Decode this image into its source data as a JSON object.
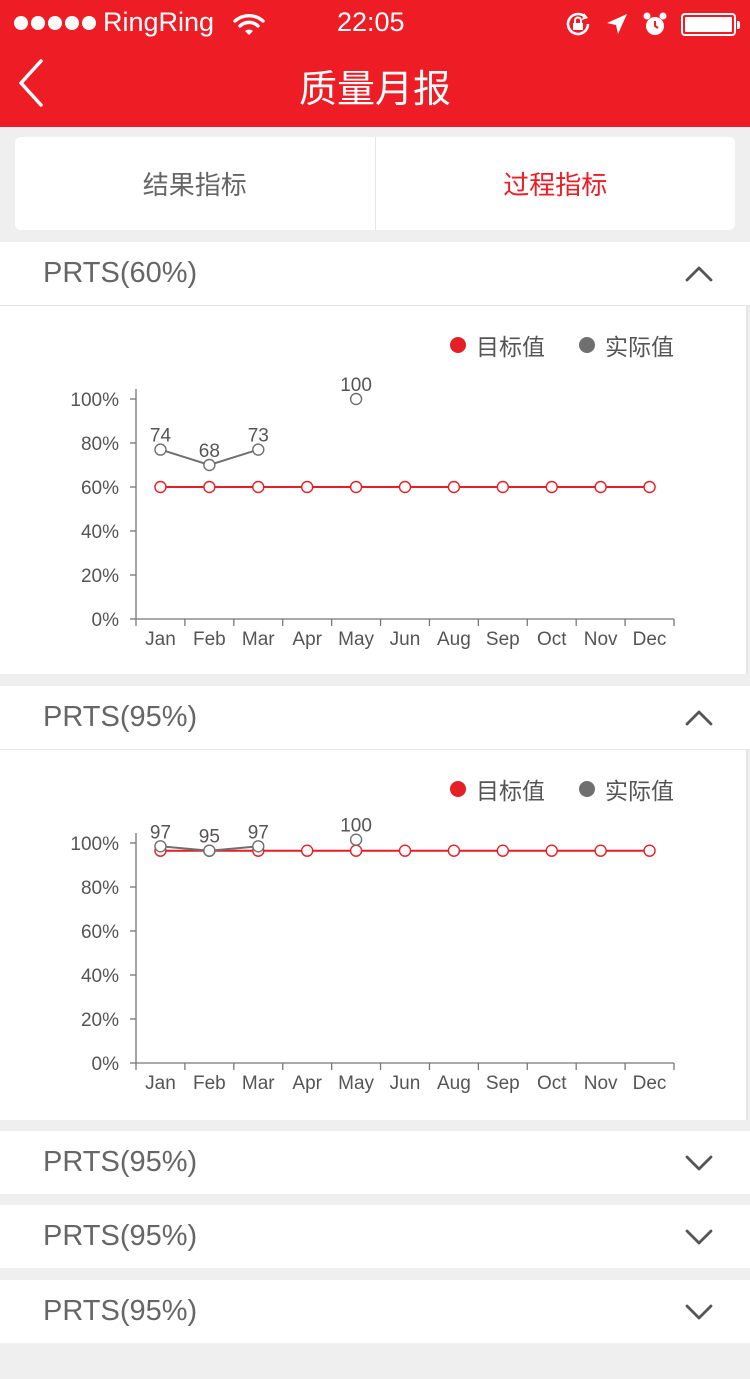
{
  "status_bar": {
    "carrier": "RingRing",
    "time": "22:05"
  },
  "header": {
    "title": "质量月报"
  },
  "tabs": [
    {
      "label": "结果指标",
      "active": false
    },
    {
      "label": "过程指标",
      "active": true
    }
  ],
  "colors": {
    "accent": "#ee1c25",
    "target": "#e41f26",
    "actual": "#6f6f6f"
  },
  "icons": [
    "back-arrow-icon",
    "wifi-icon",
    "rotation-lock-icon",
    "location-arrow-icon",
    "alarm-icon",
    "battery-icon",
    "chevron-up-icon",
    "chevron-down-icon"
  ],
  "sections": [
    {
      "title": "PRTS(60%)",
      "expanded": true
    },
    {
      "title": "PRTS(95%)",
      "expanded": true
    },
    {
      "title": "PRTS(95%)",
      "expanded": false
    },
    {
      "title": "PRTS(95%)",
      "expanded": false
    },
    {
      "title": "PRTS(95%)",
      "expanded": false
    }
  ],
  "chart_data": [
    {
      "type": "line",
      "categories": [
        "Jan",
        "Feb",
        "Mar",
        "Apr",
        "May",
        "Jun",
        "Aug",
        "Sep",
        "Oct",
        "Nov",
        "Dec"
      ],
      "ylim": [
        0,
        100
      ],
      "yticks": [
        "0%",
        "20%",
        "40%",
        "60%",
        "80%",
        "100%"
      ],
      "legend": {
        "position": "top-right"
      },
      "series": [
        {
          "name": "目标值",
          "color": "#e41f26",
          "values": [
            60,
            60,
            60,
            60,
            60,
            60,
            60,
            60,
            60,
            60,
            60
          ]
        },
        {
          "name": "实际值",
          "color": "#6f6f6f",
          "values": [
            77,
            70,
            77,
            null,
            100,
            null,
            null,
            null,
            null,
            null,
            null
          ],
          "labels": [
            "74",
            "68",
            "73",
            null,
            "100",
            null,
            null,
            null,
            null,
            null,
            null
          ]
        }
      ]
    },
    {
      "type": "line",
      "categories": [
        "Jan",
        "Feb",
        "Mar",
        "Apr",
        "May",
        "Jun",
        "Aug",
        "Sep",
        "Oct",
        "Nov",
        "Dec"
      ],
      "ylim": [
        0,
        100
      ],
      "yticks": [
        "0%",
        "20%",
        "40%",
        "60%",
        "80%",
        "100%"
      ],
      "legend": {
        "position": "top-right"
      },
      "series": [
        {
          "name": "目标值",
          "color": "#e41f26",
          "values": [
            96.5,
            96.5,
            96.5,
            96.5,
            96.5,
            96.5,
            96.5,
            96.5,
            96.5,
            96.5,
            96.5
          ]
        },
        {
          "name": "实际值",
          "color": "#6f6f6f",
          "values": [
            98.5,
            96.5,
            98.5,
            null,
            101.5,
            null,
            null,
            null,
            null,
            null,
            null
          ],
          "labels": [
            "97",
            "95",
            "97",
            null,
            "100",
            null,
            null,
            null,
            null,
            null,
            null
          ]
        }
      ]
    }
  ]
}
